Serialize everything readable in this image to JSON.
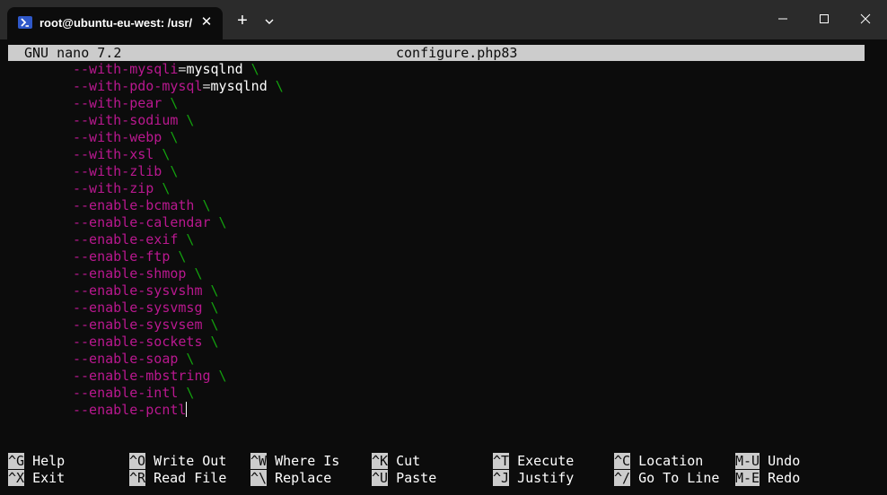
{
  "window": {
    "tab_title": "root@ubuntu-eu-west: /usr/lo",
    "tab_close": "✕",
    "new_tab": "+",
    "icons": {
      "tab": "powershell-icon",
      "dropdown": "chevron-down-icon",
      "minimize": "minimize-icon",
      "maximize": "maximize-icon",
      "close": "close-icon"
    }
  },
  "nano": {
    "version": "GNU nano 7.2",
    "filename": "configure.php83"
  },
  "lines": [
    {
      "opt": "--with-mysqli",
      "eq": "=",
      "val": "mysqlnd",
      "bs": " \\"
    },
    {
      "opt": "--with-pdo-mysql",
      "eq": "=",
      "val": "mysqlnd",
      "bs": " \\"
    },
    {
      "opt": "--with-pear",
      "eq": "",
      "val": "",
      "bs": " \\"
    },
    {
      "opt": "--with-sodium",
      "eq": "",
      "val": "",
      "bs": " \\"
    },
    {
      "opt": "--with-webp",
      "eq": "",
      "val": "",
      "bs": " \\"
    },
    {
      "opt": "--with-xsl",
      "eq": "",
      "val": "",
      "bs": " \\"
    },
    {
      "opt": "--with-zlib",
      "eq": "",
      "val": "",
      "bs": " \\"
    },
    {
      "opt": "--with-zip",
      "eq": "",
      "val": "",
      "bs": " \\"
    },
    {
      "opt": "--enable-bcmath",
      "eq": "",
      "val": "",
      "bs": " \\"
    },
    {
      "opt": "--enable-calendar",
      "eq": "",
      "val": "",
      "bs": " \\"
    },
    {
      "opt": "--enable-exif",
      "eq": "",
      "val": "",
      "bs": " \\"
    },
    {
      "opt": "--enable-ftp",
      "eq": "",
      "val": "",
      "bs": " \\"
    },
    {
      "opt": "--enable-shmop",
      "eq": "",
      "val": "",
      "bs": " \\"
    },
    {
      "opt": "--enable-sysvshm",
      "eq": "",
      "val": "",
      "bs": " \\"
    },
    {
      "opt": "--enable-sysvmsg",
      "eq": "",
      "val": "",
      "bs": " \\"
    },
    {
      "opt": "--enable-sysvsem",
      "eq": "",
      "val": "",
      "bs": " \\"
    },
    {
      "opt": "--enable-sockets",
      "eq": "",
      "val": "",
      "bs": " \\"
    },
    {
      "opt": "--enable-soap",
      "eq": "",
      "val": "",
      "bs": " \\"
    },
    {
      "opt": "--enable-mbstring",
      "eq": "",
      "val": "",
      "bs": " \\"
    },
    {
      "opt": "--enable-intl",
      "eq": "",
      "val": "",
      "bs": " \\"
    },
    {
      "opt": "--enable-pcntl",
      "eq": "",
      "val": "",
      "bs": ""
    }
  ],
  "shortcuts": [
    [
      {
        "key": "^G",
        "label": "Help"
      },
      {
        "key": "^X",
        "label": "Exit"
      }
    ],
    [
      {
        "key": "^O",
        "label": "Write Out"
      },
      {
        "key": "^R",
        "label": "Read File"
      }
    ],
    [
      {
        "key": "^W",
        "label": "Where Is"
      },
      {
        "key": "^\\",
        "label": "Replace"
      }
    ],
    [
      {
        "key": "^K",
        "label": "Cut"
      },
      {
        "key": "^U",
        "label": "Paste"
      }
    ],
    [
      {
        "key": "^T",
        "label": "Execute"
      },
      {
        "key": "^J",
        "label": "Justify"
      }
    ],
    [
      {
        "key": "^C",
        "label": "Location"
      },
      {
        "key": "^/",
        "label": "Go To Line"
      }
    ],
    [
      {
        "key": "M-U",
        "label": "Undo"
      },
      {
        "key": "M-E",
        "label": "Redo"
      }
    ]
  ],
  "colors": {
    "option": "#b9188f",
    "backslash": "#13a10e",
    "text": "#cccccc",
    "background": "#0c0c0c",
    "titlebar": "#2b2b2b"
  }
}
